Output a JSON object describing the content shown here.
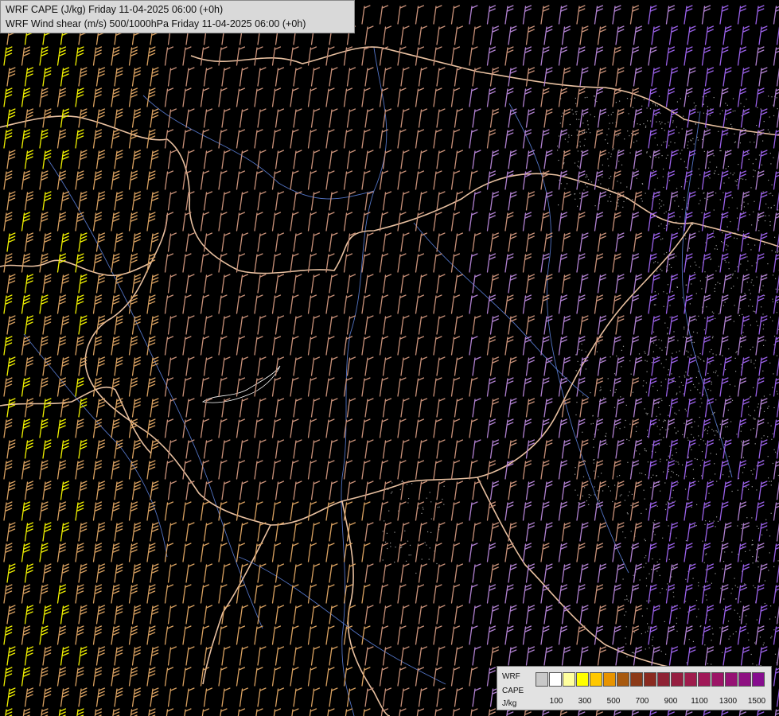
{
  "title": {
    "line1": "WRF CAPE (J/kg) Friday 11-04-2025 06:00 (+0h)",
    "line2": "WRF Wind shear (m/s) 500/1000hPa Friday 11-04-2025 06:00 (+0h)"
  },
  "legend": {
    "label1": "WRF",
    "label2": "CAPE",
    "label3": "J/kg",
    "colors": [
      "#c8c8c8",
      "#ffffff",
      "#ffff9e",
      "#ffff00",
      "#ffc800",
      "#e89400",
      "#a85a10",
      "#8c3a18",
      "#8a2a20",
      "#8e2234",
      "#961e40",
      "#9e1c4c",
      "#a01858",
      "#9c1466",
      "#961274",
      "#8e1082",
      "#860c8e"
    ],
    "ticks": [
      "100",
      "300",
      "500",
      "700",
      "900",
      "1100",
      "1300",
      "1500"
    ]
  },
  "map": {
    "barb_colors": [
      "#d8a060",
      "#f0f000",
      "#c89078",
      "#b080d0",
      "#9a60e8"
    ],
    "border_color": "#e8c0a0",
    "river_color": "#5b7fd8"
  }
}
